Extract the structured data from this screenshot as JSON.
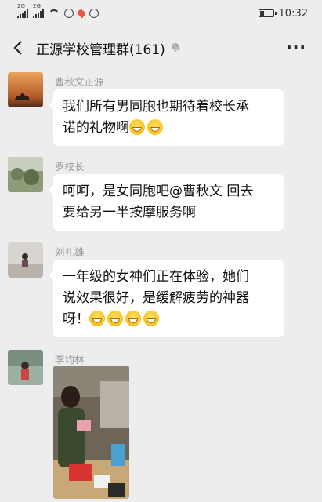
{
  "status_bar": {
    "net1": "2G",
    "net2": "2G",
    "time": "10:32",
    "battery_level": 0.35
  },
  "nav": {
    "title": "正源学校管理群(161)",
    "back_icon": "chevron-left-icon",
    "mute_icon": "bell-muted-icon",
    "more_icon": "more-dots-icon",
    "more_label": "···"
  },
  "messages": [
    {
      "sender": "曹秋文正源",
      "line1": "我们所有男同胞也期待着校长承",
      "line2": "诺的礼物啊"
    },
    {
      "sender": "罗校长",
      "line1": "呵呵，是女同胞吧@曹秋文  回去",
      "line2": "要给另一半按摩服务啊"
    },
    {
      "sender": "刘礼雄",
      "line1": "一年级的女神们正在体验，她们",
      "line2": "说效果很好，是缓解疲劳的神器",
      "line3": "呀！"
    },
    {
      "sender": "李均林"
    }
  ]
}
